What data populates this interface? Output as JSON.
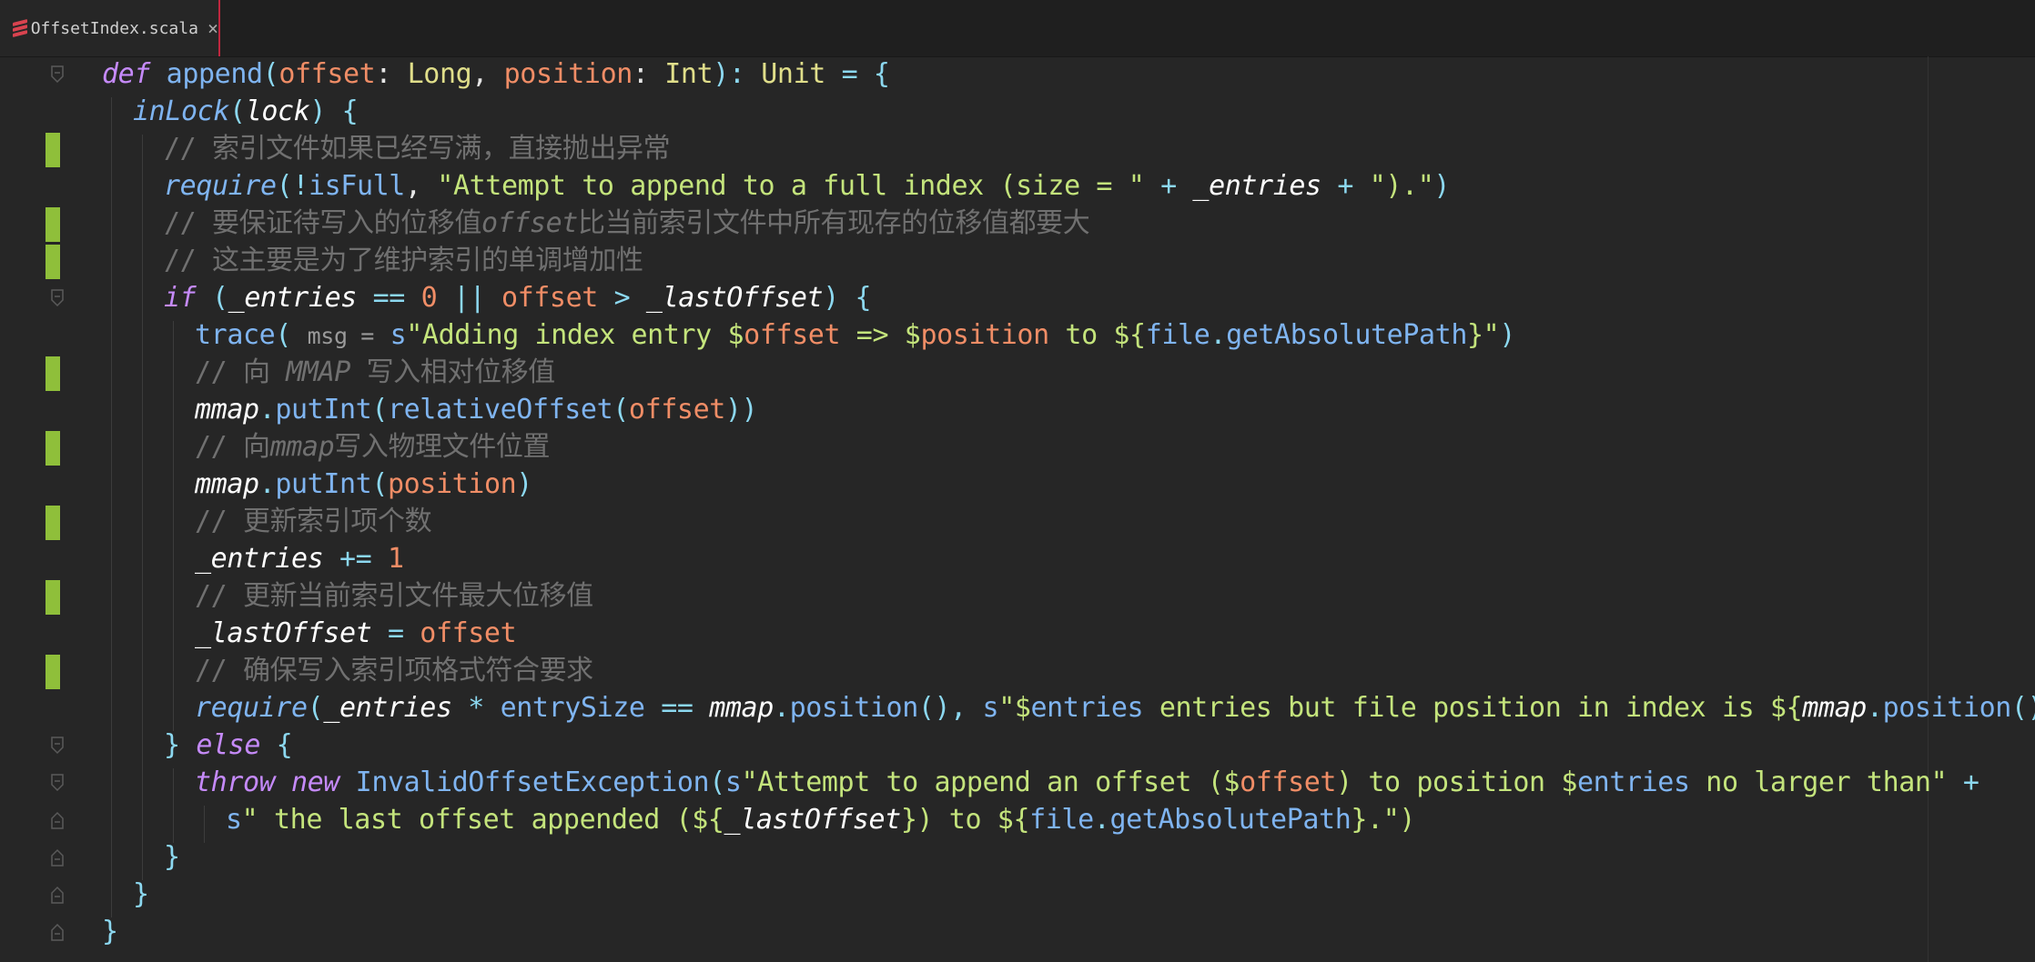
{
  "editor": {
    "tab": {
      "label": "OffsetIndex.scala",
      "close_icon": "×"
    }
  },
  "code": [
    [
      [
        "def",
        "t-kw"
      ],
      [
        " ",
        ""
      ],
      [
        "append",
        "t-fn"
      ],
      [
        "(",
        "t-p"
      ],
      [
        "offset",
        "t-par"
      ],
      [
        ": ",
        "t-w"
      ],
      [
        "Long",
        "t-typ"
      ],
      [
        ", ",
        "t-w"
      ],
      [
        "position",
        "t-par"
      ],
      [
        ": ",
        "t-w"
      ],
      [
        "Int",
        "t-typ"
      ],
      [
        "): ",
        "t-p"
      ],
      [
        "Unit",
        "t-typ"
      ],
      [
        " = {",
        "t-op"
      ]
    ],
    [
      [
        "inLock",
        "t-fni"
      ],
      [
        "(",
        "t-p"
      ],
      [
        "lock",
        "t-ital"
      ],
      [
        ") {",
        "t-p"
      ]
    ],
    [
      [
        "// 索引文件如果已经写满，直接抛出异常",
        "t-cm"
      ]
    ],
    [
      [
        "require",
        "t-fni"
      ],
      [
        "(",
        "t-p"
      ],
      [
        "!",
        "t-op"
      ],
      [
        "isFull",
        "t-fn"
      ],
      [
        ", ",
        "t-w"
      ],
      [
        "\"Attempt to append to a full index (size = \"",
        "t-str"
      ],
      [
        " + ",
        "t-op"
      ],
      [
        "_entries",
        "t-ital"
      ],
      [
        " + ",
        "t-op"
      ],
      [
        "\").\"",
        "t-str"
      ],
      [
        ")",
        "t-p"
      ]
    ],
    [
      [
        "// 要保证待写入的位移值",
        "t-cm"
      ],
      [
        "offset",
        "t-cmi"
      ],
      [
        "比当前索引文件中所有现存的位移值都要大",
        "t-cm"
      ]
    ],
    [
      [
        "// 这主要是为了维护索引的单调增加性",
        "t-cm"
      ]
    ],
    [
      [
        "if",
        "t-kw"
      ],
      [
        " (",
        "t-p"
      ],
      [
        "_entries",
        "t-ital"
      ],
      [
        " == ",
        "t-op"
      ],
      [
        "0",
        "t-num"
      ],
      [
        " || ",
        "t-op"
      ],
      [
        "offset",
        "t-par"
      ],
      [
        " > ",
        "t-op"
      ],
      [
        "_lastOffset",
        "t-ital"
      ],
      [
        ") {",
        "t-p"
      ]
    ],
    [
      [
        "trace",
        "t-fn"
      ],
      [
        "( ",
        "t-p"
      ],
      [
        "msg =",
        "t-dim"
      ],
      [
        " ",
        ""
      ],
      [
        "s",
        "t-fn"
      ],
      [
        "\"Adding index entry $",
        "t-str"
      ],
      [
        "offset",
        "t-par"
      ],
      [
        " => $",
        "t-str"
      ],
      [
        "position",
        "t-par"
      ],
      [
        " to ${",
        "t-str"
      ],
      [
        "file",
        "t-fn"
      ],
      [
        ".",
        "t-op"
      ],
      [
        "getAbsolutePath",
        "t-fn"
      ],
      [
        "}\"",
        "t-str"
      ],
      [
        ")",
        "t-p"
      ]
    ],
    [
      [
        "// 向 ",
        "t-cm"
      ],
      [
        "MMAP",
        "t-cmi"
      ],
      [
        " 写入相对位移值",
        "t-cm"
      ]
    ],
    [
      [
        "mmap",
        "t-ital"
      ],
      [
        ".",
        "t-op"
      ],
      [
        "putInt",
        "t-fn"
      ],
      [
        "(",
        "t-p"
      ],
      [
        "relativeOffset",
        "t-fn"
      ],
      [
        "(",
        "t-p"
      ],
      [
        "offset",
        "t-par"
      ],
      [
        "))",
        "t-p"
      ]
    ],
    [
      [
        "// 向",
        "t-cm"
      ],
      [
        "mmap",
        "t-cmi"
      ],
      [
        "写入物理文件位置",
        "t-cm"
      ]
    ],
    [
      [
        "mmap",
        "t-ital"
      ],
      [
        ".",
        "t-op"
      ],
      [
        "putInt",
        "t-fn"
      ],
      [
        "(",
        "t-p"
      ],
      [
        "position",
        "t-par"
      ],
      [
        ")",
        "t-p"
      ]
    ],
    [
      [
        "// 更新索引项个数",
        "t-cm"
      ]
    ],
    [
      [
        "_entries",
        "t-ital"
      ],
      [
        " += ",
        "t-op"
      ],
      [
        "1",
        "t-num"
      ]
    ],
    [
      [
        "// 更新当前索引文件最大位移值",
        "t-cm"
      ]
    ],
    [
      [
        "_lastOffset",
        "t-ital"
      ],
      [
        " = ",
        "t-op"
      ],
      [
        "offset",
        "t-par"
      ]
    ],
    [
      [
        "// 确保写入索引项格式符合要求",
        "t-cm"
      ]
    ],
    [
      [
        "require",
        "t-fni"
      ],
      [
        "(",
        "t-p"
      ],
      [
        "_entries",
        "t-ital"
      ],
      [
        " * ",
        "t-op"
      ],
      [
        "entrySize",
        "t-fn"
      ],
      [
        " == ",
        "t-op"
      ],
      [
        "mmap",
        "t-ital"
      ],
      [
        ".",
        "t-op"
      ],
      [
        "position",
        "t-fn"
      ],
      [
        "(), ",
        "t-p"
      ],
      [
        "s",
        "t-fn"
      ],
      [
        "\"$",
        "t-str"
      ],
      [
        "entries",
        "t-fn"
      ],
      [
        " entries but file position in index is ${",
        "t-str"
      ],
      [
        "mmap",
        "t-ital"
      ],
      [
        ".",
        "t-op"
      ],
      [
        "position",
        "t-fn"
      ],
      [
        "()",
        "t-p"
      ],
      [
        "}.\")",
        "t-str"
      ]
    ],
    [
      [
        "} ",
        "t-p"
      ],
      [
        "else",
        "t-kw"
      ],
      [
        " {",
        "t-p"
      ]
    ],
    [
      [
        "throw",
        "t-kw"
      ],
      [
        " ",
        ""
      ],
      [
        "new",
        "t-kw"
      ],
      [
        " ",
        ""
      ],
      [
        "InvalidOffsetException",
        "t-fn"
      ],
      [
        "(",
        "t-p"
      ],
      [
        "s",
        "t-fn"
      ],
      [
        "\"Attempt to append an offset ($",
        "t-str"
      ],
      [
        "offset",
        "t-par"
      ],
      [
        ") to position $",
        "t-str"
      ],
      [
        "entries",
        "t-fn"
      ],
      [
        " no larger than\"",
        "t-str"
      ],
      [
        " +",
        "t-op"
      ]
    ],
    [
      [
        "s",
        "t-fn"
      ],
      [
        "\" the last offset appended (${",
        "t-str"
      ],
      [
        "_lastOffset",
        "t-ital"
      ],
      [
        "}) to ${",
        "t-str"
      ],
      [
        "file",
        "t-fn"
      ],
      [
        ".",
        "t-op"
      ],
      [
        "getAbsolutePath",
        "t-fn"
      ],
      [
        "}.\")",
        "t-str"
      ]
    ],
    [
      [
        "}",
        "t-p"
      ]
    ],
    [
      [
        "}",
        "t-p"
      ]
    ],
    [
      [
        "}",
        "t-p"
      ]
    ]
  ]
}
